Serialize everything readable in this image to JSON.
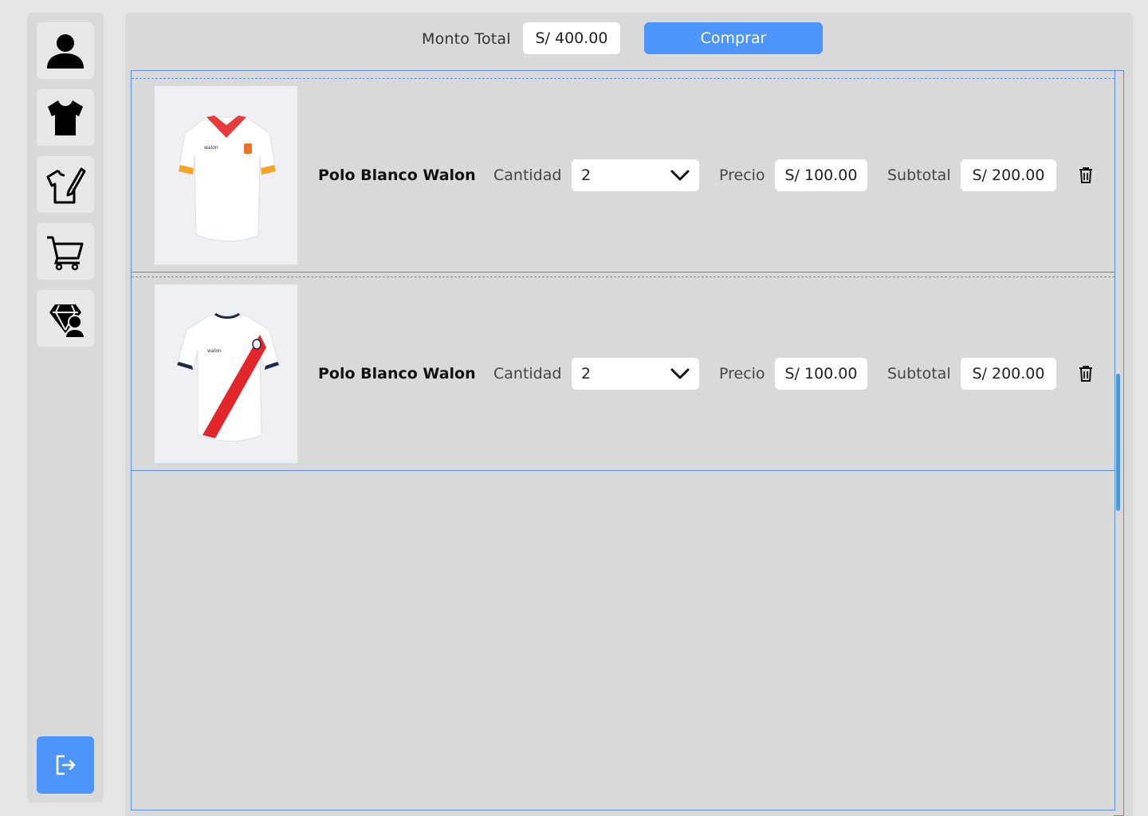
{
  "sidebar": {
    "items": [
      {
        "icon": "user-icon"
      },
      {
        "icon": "tshirt-icon"
      },
      {
        "icon": "tshirt-design-icon"
      },
      {
        "icon": "cart-icon"
      },
      {
        "icon": "diamond-user-icon"
      }
    ],
    "logout_icon": "logout-icon"
  },
  "header": {
    "total_label": "Monto Total",
    "total_value": "S/ 400.00",
    "buy_label": "Comprar"
  },
  "cart": {
    "items": [
      {
        "name": "Polo Blanco Walon",
        "qty_label": "Cantidad",
        "qty": "2",
        "price_label": "Precio",
        "price": "S/ 100.00",
        "subtotal_label": "Subtotal",
        "subtotal": "S/ 200.00",
        "image": "white-jersey-orange-collar"
      },
      {
        "name": "Polo Blanco Walon",
        "qty_label": "Cantidad",
        "qty": "2",
        "price_label": "Precio",
        "price": "S/ 100.00",
        "subtotal_label": "Subtotal",
        "subtotal": "S/ 200.00",
        "image": "white-jersey-red-sash"
      }
    ]
  },
  "colors": {
    "accent": "#4d94fb",
    "panel": "#d9d9d9",
    "background": "#e5e5e5",
    "border": "#5b8fe0"
  }
}
